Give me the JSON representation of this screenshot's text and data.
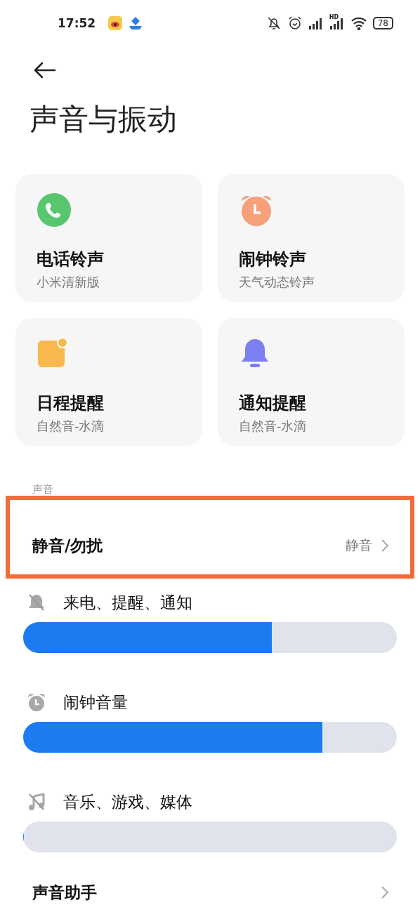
{
  "status_bar": {
    "time": "17:52",
    "network_label": "HD",
    "battery": "78"
  },
  "title": "声音与振动",
  "cards": [
    {
      "kind": "phone",
      "title": "电话铃声",
      "subtitle": "小米清新版"
    },
    {
      "kind": "alarm",
      "title": "闹钟铃声",
      "subtitle": "天气动态铃声"
    },
    {
      "kind": "calendar",
      "title": "日程提醒",
      "subtitle": "自然音-水滴"
    },
    {
      "kind": "bell",
      "title": "通知提醒",
      "subtitle": "自然音-水滴"
    }
  ],
  "section_label": "声音",
  "dnd_row": {
    "label": "静音/勿扰",
    "value": "静音",
    "highlighted": true
  },
  "volumes": [
    {
      "kind": "bell",
      "label": "来电、提醒、通知",
      "muted": true,
      "level": 0.665
    },
    {
      "kind": "alarm",
      "label": "闹钟音量",
      "muted": false,
      "level": 0.8
    },
    {
      "kind": "music",
      "label": "音乐、游戏、媒体",
      "muted": true,
      "level": 0
    }
  ],
  "assistant_row": {
    "label": "声音助手"
  }
}
